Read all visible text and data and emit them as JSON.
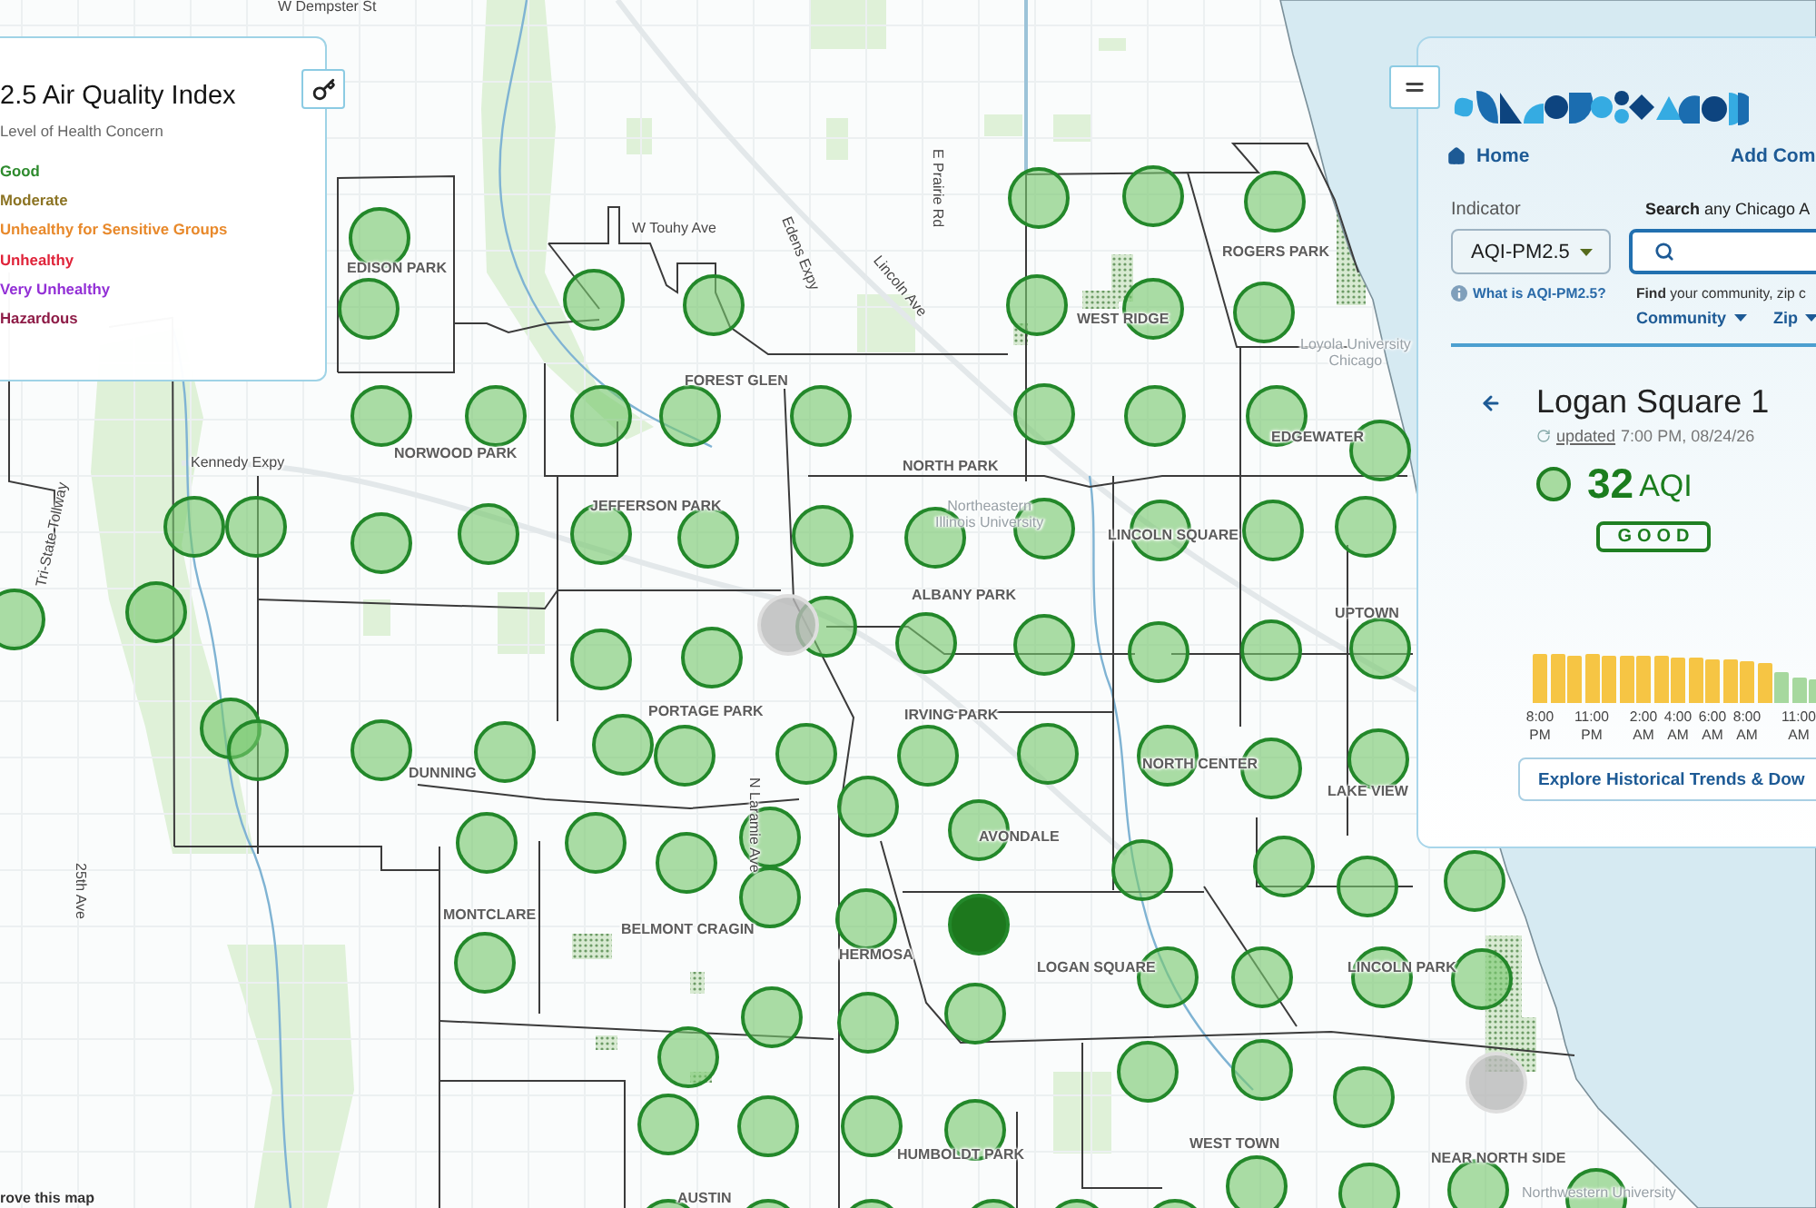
{
  "legend": {
    "title": "2.5 Air Quality Index",
    "subtitle": "Level of Health Concern",
    "items": [
      {
        "label": "Good",
        "color": "#2e8b2e"
      },
      {
        "label": "Moderate",
        "color": "#8c7424"
      },
      {
        "label": "Unhealthy for Sensitive Groups",
        "color": "#e8892b"
      },
      {
        "label": "Unhealthy",
        "color": "#e0243a"
      },
      {
        "label": "Very Unhealthy",
        "color": "#9330d6"
      },
      {
        "label": "Hazardous",
        "color": "#8e1c47"
      }
    ]
  },
  "map": {
    "labels": [
      {
        "kind": "street",
        "text": "W Dempster St"
      },
      {
        "kind": "street",
        "text": "E Prairie Rd"
      },
      {
        "kind": "street",
        "text": "W Touhy Ave"
      },
      {
        "kind": "street",
        "text": "Edens Expy"
      },
      {
        "kind": "community",
        "text": "ROGERS PARK"
      },
      {
        "kind": "community",
        "text": "EDISON PARK"
      },
      {
        "kind": "street",
        "text": "Lincoln Ave"
      },
      {
        "kind": "community",
        "text": "WEST RIDGE"
      },
      {
        "kind": "campus",
        "text": "Loyola University\nChicago"
      },
      {
        "kind": "community",
        "text": "FOREST GLEN"
      },
      {
        "kind": "community",
        "text": "EDGEWATER"
      },
      {
        "kind": "community",
        "text": "NORWOOD PARK"
      },
      {
        "kind": "street",
        "text": "Kennedy Expy"
      },
      {
        "kind": "community",
        "text": "NORTH PARK"
      },
      {
        "kind": "street",
        "text": "Tri-State Tollway"
      },
      {
        "kind": "community",
        "text": "JEFFERSON PARK"
      },
      {
        "kind": "campus",
        "text": "Northeastern\nIllinois University"
      },
      {
        "kind": "community",
        "text": "LINCOLN SQUARE"
      },
      {
        "kind": "community",
        "text": "ALBANY PARK"
      },
      {
        "kind": "community",
        "text": "UPTOWN"
      },
      {
        "kind": "community",
        "text": "PORTAGE PARK"
      },
      {
        "kind": "community",
        "text": "IRVING PARK"
      },
      {
        "kind": "community",
        "text": "NORTH CENTER"
      },
      {
        "kind": "community",
        "text": "DUNNING"
      },
      {
        "kind": "community",
        "text": "LAKE VIEW"
      },
      {
        "kind": "street",
        "text": "N Laramie Ave"
      },
      {
        "kind": "community",
        "text": "AVONDALE"
      },
      {
        "kind": "street",
        "text": "25th Ave"
      },
      {
        "kind": "community",
        "text": "MONTCLARE"
      },
      {
        "kind": "community",
        "text": "BELMONT CRAGIN"
      },
      {
        "kind": "community",
        "text": "HERMOSA"
      },
      {
        "kind": "community",
        "text": "LOGAN SQUARE"
      },
      {
        "kind": "community",
        "text": "LINCOLN PARK"
      },
      {
        "kind": "community",
        "text": "WEST TOWN"
      },
      {
        "kind": "community",
        "text": "HUMBOLDT PARK"
      },
      {
        "kind": "community",
        "text": "NEAR NORTH SIDE"
      },
      {
        "kind": "attribution",
        "text": "rove this map"
      },
      {
        "kind": "community",
        "text": "AUSTIN"
      },
      {
        "kind": "campus",
        "text": "Northwestern University"
      }
    ],
    "sensors": [
      {
        "kind": "good",
        "selected": false
      },
      {
        "kind": "good",
        "selected": false
      },
      {
        "kind": "good",
        "selected": false
      },
      {
        "kind": "good",
        "selected": false
      },
      {
        "kind": "good",
        "selected": false
      },
      {
        "kind": "good",
        "selected": false
      },
      {
        "kind": "good",
        "selected": false
      },
      {
        "kind": "good",
        "selected": false
      },
      {
        "kind": "good",
        "selected": false
      },
      {
        "kind": "good",
        "selected": false
      },
      {
        "kind": "good",
        "selected": false
      },
      {
        "kind": "good",
        "selected": false
      },
      {
        "kind": "good",
        "selected": false
      },
      {
        "kind": "good",
        "selected": false
      },
      {
        "kind": "good",
        "selected": false
      },
      {
        "kind": "good",
        "selected": false
      },
      {
        "kind": "good",
        "selected": false
      },
      {
        "kind": "good",
        "selected": false
      },
      {
        "kind": "good",
        "selected": false
      },
      {
        "kind": "good",
        "selected": false
      },
      {
        "kind": "good",
        "selected": false
      },
      {
        "kind": "good",
        "selected": false
      },
      {
        "kind": "good",
        "selected": false
      },
      {
        "kind": "good",
        "selected": false
      },
      {
        "kind": "good",
        "selected": false
      },
      {
        "kind": "good",
        "selected": false
      },
      {
        "kind": "good",
        "selected": false
      },
      {
        "kind": "good",
        "selected": false
      },
      {
        "kind": "good",
        "selected": false
      },
      {
        "kind": "good",
        "selected": false
      },
      {
        "kind": "good",
        "selected": false
      },
      {
        "kind": "good",
        "selected": false
      },
      {
        "kind": "good",
        "selected": false
      },
      {
        "kind": "good",
        "selected": false
      },
      {
        "kind": "no_data",
        "selected": false
      },
      {
        "kind": "good",
        "selected": false
      },
      {
        "kind": "good",
        "selected": false
      },
      {
        "kind": "good",
        "selected": false
      },
      {
        "kind": "good",
        "selected": false
      },
      {
        "kind": "good",
        "selected": false
      },
      {
        "kind": "good",
        "selected": false
      },
      {
        "kind": "good",
        "selected": false
      },
      {
        "kind": "good",
        "selected": false
      },
      {
        "kind": "good",
        "selected": false
      },
      {
        "kind": "good",
        "selected": false
      },
      {
        "kind": "good",
        "selected": false
      },
      {
        "kind": "good",
        "selected": false
      },
      {
        "kind": "good",
        "selected": false
      },
      {
        "kind": "good",
        "selected": false
      },
      {
        "kind": "good",
        "selected": false
      },
      {
        "kind": "good",
        "selected": false
      },
      {
        "kind": "good",
        "selected": false
      },
      {
        "kind": "good",
        "selected": false
      },
      {
        "kind": "good",
        "selected": false
      },
      {
        "kind": "good",
        "selected": false
      },
      {
        "kind": "good",
        "selected": false
      },
      {
        "kind": "good",
        "selected": false
      },
      {
        "kind": "good",
        "selected": false
      },
      {
        "kind": "good",
        "selected": false
      },
      {
        "kind": "good",
        "selected": false
      },
      {
        "kind": "good",
        "selected": false
      },
      {
        "kind": "good",
        "selected": false
      },
      {
        "kind": "good",
        "selected": true
      },
      {
        "kind": "good",
        "selected": false
      },
      {
        "kind": "good",
        "selected": false
      },
      {
        "kind": "good",
        "selected": false
      },
      {
        "kind": "good",
        "selected": false
      },
      {
        "kind": "good",
        "selected": false
      },
      {
        "kind": "good",
        "selected": false
      },
      {
        "kind": "good",
        "selected": false
      },
      {
        "kind": "good",
        "selected": false
      },
      {
        "kind": "good",
        "selected": false
      },
      {
        "kind": "good",
        "selected": false
      },
      {
        "kind": "good",
        "selected": false
      },
      {
        "kind": "good",
        "selected": false
      },
      {
        "kind": "good",
        "selected": false
      },
      {
        "kind": "good",
        "selected": false
      },
      {
        "kind": "good",
        "selected": false
      },
      {
        "kind": "good",
        "selected": false
      },
      {
        "kind": "no_data",
        "selected": false
      },
      {
        "kind": "good",
        "selected": false
      },
      {
        "kind": "good",
        "selected": false
      },
      {
        "kind": "good",
        "selected": false
      },
      {
        "kind": "good",
        "selected": false
      },
      {
        "kind": "good",
        "selected": false
      },
      {
        "kind": "good",
        "selected": false
      },
      {
        "kind": "good",
        "selected": false
      },
      {
        "kind": "good",
        "selected": false
      },
      {
        "kind": "good",
        "selected": false
      },
      {
        "kind": "good",
        "selected": false
      },
      {
        "kind": "good",
        "selected": false
      },
      {
        "kind": "good",
        "selected": false
      },
      {
        "kind": "good",
        "selected": false
      },
      {
        "kind": "good",
        "selected": false
      }
    ]
  },
  "panel": {
    "nav": {
      "home": "Home",
      "add": "Add Com"
    },
    "indicator": {
      "label": "Indicator",
      "value": "AQI-PM2.5",
      "help": "What is AQI-PM2.5?"
    },
    "search": {
      "label": "**Search** any Chicago A",
      "hint": "**Find** your community, zip c",
      "filters": [
        "Community",
        "Zip"
      ]
    },
    "station": {
      "name": "Logan Square 1",
      "updated_link": "updated",
      "updated_time": "7:00 PM, 08/24/26",
      "value": "32",
      "unit": "AQI",
      "category": "GOOD",
      "kind": "good"
    },
    "hourly_bars": [
      {
        "kind": "moderate",
        "label": "8:00\nPM"
      },
      {
        "kind": "moderate"
      },
      {
        "kind": "moderate"
      },
      {
        "kind": "moderate",
        "label": "11:00\nPM"
      },
      {
        "kind": "moderate"
      },
      {
        "kind": "moderate"
      },
      {
        "kind": "moderate",
        "label": "2:00\nAM"
      },
      {
        "kind": "moderate"
      },
      {
        "kind": "moderate",
        "label": "4:00\nAM"
      },
      {
        "kind": "moderate"
      },
      {
        "kind": "moderate",
        "label": "6:00\nAM"
      },
      {
        "kind": "moderate"
      },
      {
        "kind": "moderate",
        "label": "8:00\nAM"
      },
      {
        "kind": "moderate"
      },
      {
        "kind": "good"
      },
      {
        "kind": "good",
        "label": "11:00\nAM"
      },
      {
        "kind": "good"
      }
    ],
    "explore_button": "Explore Historical Trends & Dow"
  }
}
